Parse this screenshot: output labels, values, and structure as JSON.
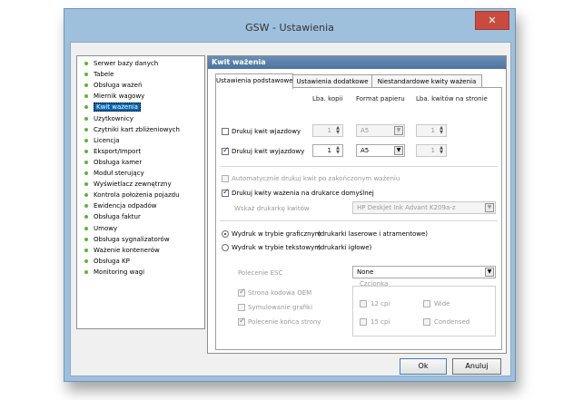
{
  "window": {
    "title": "GSW - Ustawienia",
    "close_symbol": "✕"
  },
  "sidebar": {
    "items": [
      "Serwer bazy danych",
      "Tabele",
      "Obsługa ważeń",
      "Miernik wagowy",
      "Kwit ważenia",
      "Użytkownicy",
      "Czytniki kart zbliżeniowych",
      "Licencja",
      "Eksport/Import",
      "Obsługa kamer",
      "Moduł sterujący",
      "Wyświetlacz zewnętrzny",
      "Kontrola położenia pojazdu",
      "Ewidencja odpadów",
      "Obsługa faktur",
      "Umowy",
      "Obsługa sygnalizatorów",
      "Ważenie kontenerów",
      "Obsługa KP",
      "Monitoring wagi"
    ],
    "selected": "Kwit ważenia"
  },
  "panel": {
    "header": "Kwit ważenia",
    "tabs": [
      "Ustawienia podstawowe",
      "Ustawienia dodatkowe",
      "Niestandardowe kwity ważenia"
    ],
    "active_tab": "Ustawienia podstawowe"
  },
  "table": {
    "col_copies": "Lba. kopii",
    "col_format": "Format papieru",
    "col_per_page": "Lba. kwitów na stronie",
    "rows": [
      {
        "label": "Drukuj kwit wjazdowy",
        "checked": false,
        "copies": "1",
        "format": "A5",
        "per_page": "1"
      },
      {
        "label": "Drukuj kwit wyjazdowy",
        "checked": true,
        "copies": "1",
        "format": "A5",
        "per_page": "1"
      }
    ]
  },
  "options": {
    "auto_print": "Automatycznie drukuj kwit po zakończonym ważeniu",
    "default_printer": "Drukuj kwity ważenia na drukarce domyślnej",
    "printer_label": "Wskaż drukarkę kwitów",
    "printer_value": "HP Deskjet Ink Advant K209a-z"
  },
  "print_mode": {
    "graphic": "Wydruk w trybie graficznym",
    "graphic_note": "(drukarki laserowe i atramentowe)",
    "text": "Wydruk w trybie tekstowym",
    "text_note": "(drukarki igłowe)"
  },
  "esc": {
    "label": "Polecenie ESC",
    "value": "None"
  },
  "text_options": {
    "oem": "Strona kodowa OEM",
    "sim": "Symulowanie grafiki",
    "endpage": "Polecenie końca strony"
  },
  "font_group": {
    "title": "Czcionka",
    "cpi12": "12 cpi",
    "cpi15": "15 cpi",
    "wide": "Wide",
    "condensed": "Condensed"
  },
  "buttons": {
    "ok": "Ok",
    "cancel": "Anuluj"
  },
  "icons": {
    "spin": "spin-arrows-icon",
    "dropdown": "dropdown-arrow-icon",
    "check": "checkmark-icon"
  }
}
